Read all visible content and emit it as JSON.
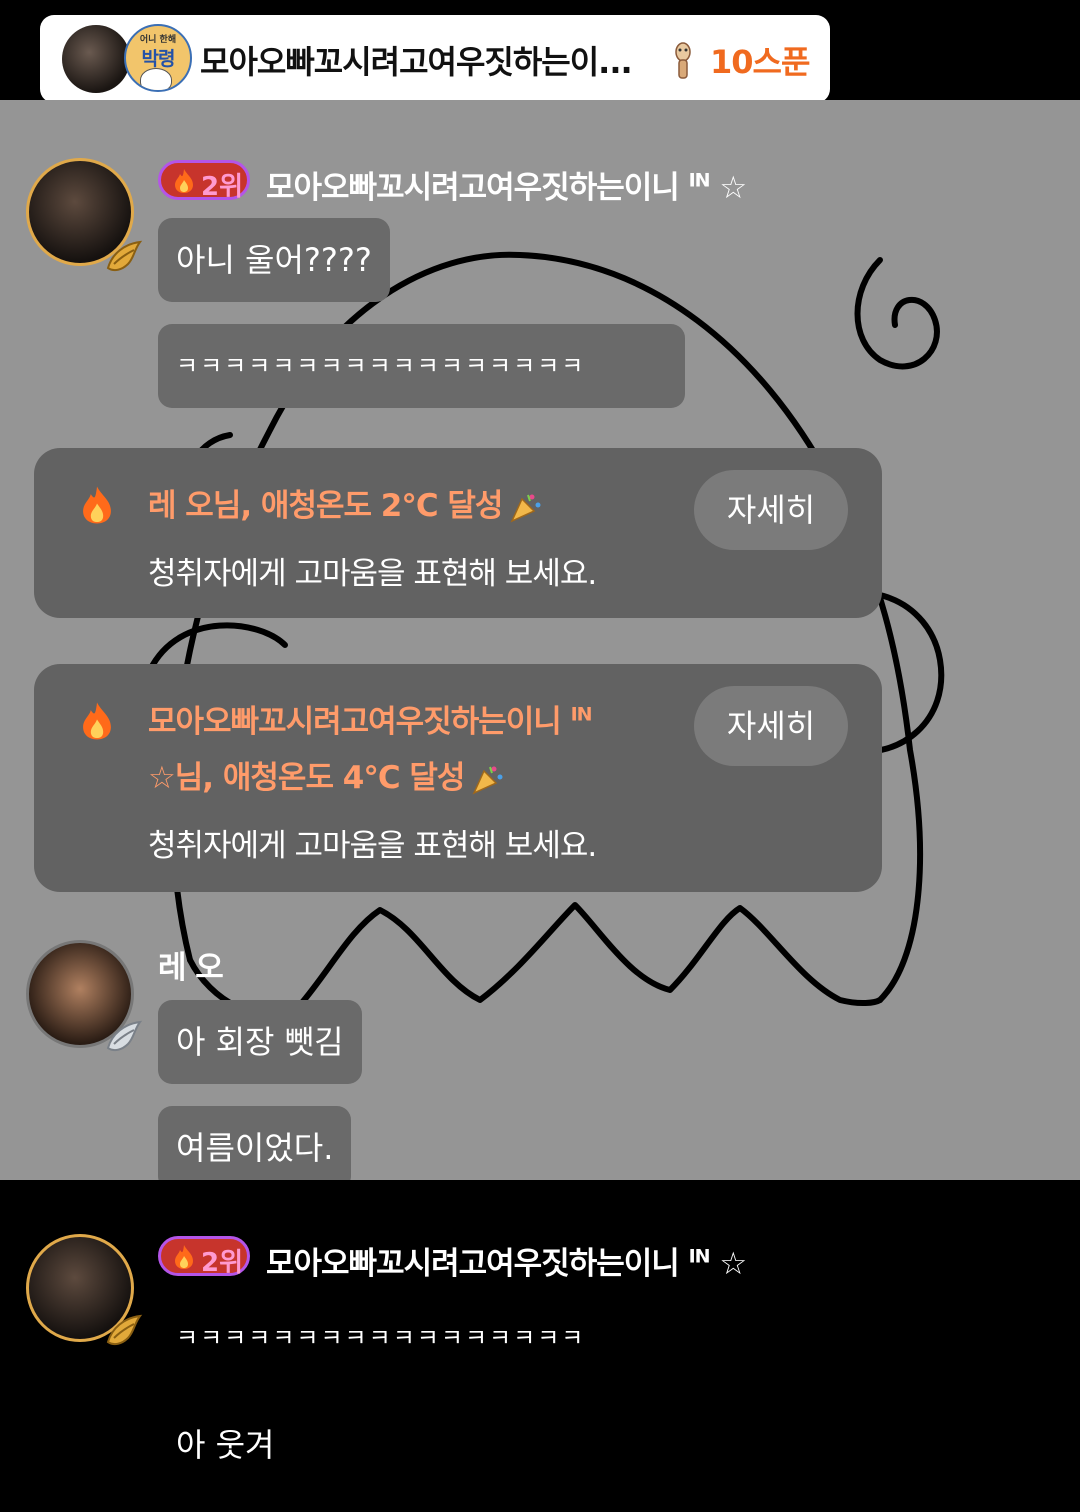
{
  "header": {
    "title": "모아오빠꼬시려고여우짓하는이...",
    "badge_top": "어니 한해",
    "badge_main": "박령",
    "spoon_label": "10스푼"
  },
  "chat": {
    "rank_text": "2위",
    "user1_name": "모아오빠꼬시려고여우짓하는이니",
    "user1_suffix": "IN",
    "user1_star": "☆",
    "msg1": "아니 울어????",
    "msg2": "ㅋㅋㅋㅋㅋㅋㅋㅋㅋㅋㅋㅋㅋㅋㅋㅋㅋ",
    "notice1_title": "레 오님, 애청온도 2°C 달성",
    "notice1_sub": "청취자에게 고마움을 표현해 보세요.",
    "notice1_button": "자세히",
    "notice2_title_line1": "모아오빠꼬시려고여우짓하는이니",
    "notice2_title_sup": "IN",
    "notice2_title_line2": "☆님, 애청온도 4°C 달성",
    "notice2_sub": "청취자에게 고마움을 표현해 보세요.",
    "notice2_button": "자세히",
    "user2_name": "레 오",
    "msg3": "아 회장 뺏김",
    "msg4": "여름이었다.",
    "bottom_rank_text": "2위",
    "bottom_user_name": "모아오빠꼬시려고여우짓하는이니",
    "bottom_user_suffix": "IN",
    "bottom_user_star": "☆",
    "bottom_msg1": "ㅋㅋㅋㅋㅋㅋㅋㅋㅋㅋㅋㅋㅋㅋㅋㅋㅋ",
    "bottom_msg2": "아 웃겨"
  },
  "colors": {
    "overlay_gray": "#959595",
    "bubble": "#6a6a6a",
    "notice_title": "#ff9b6a",
    "spoon": "#f06a1f",
    "rank_border": "#b455e8"
  },
  "icons": [
    "spoon-icon",
    "flame-icon",
    "party-popper-icon",
    "gold-wing-emblem-icon",
    "silver-wing-emblem-icon"
  ]
}
